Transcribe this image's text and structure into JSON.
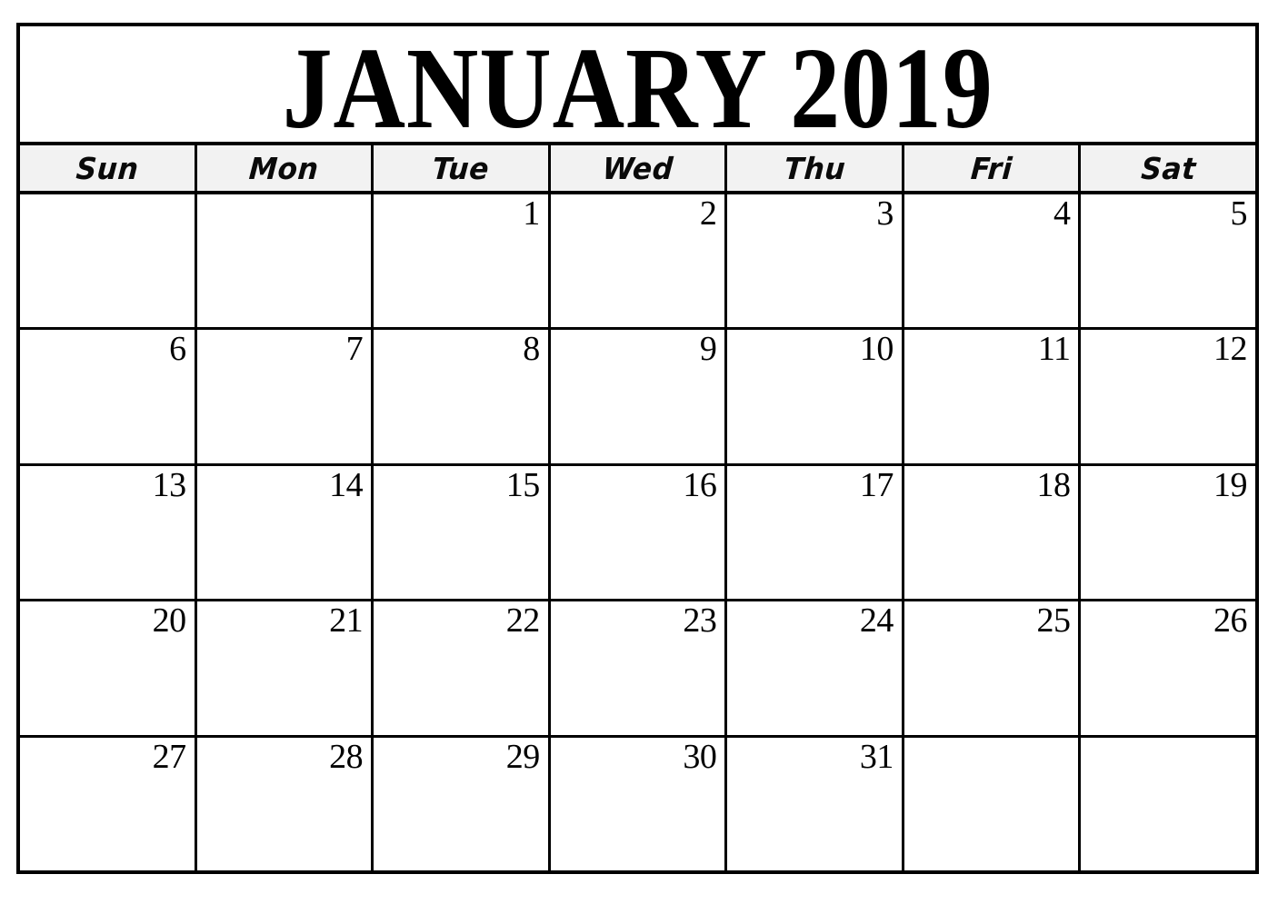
{
  "calendar": {
    "title": "JANUARY 2019",
    "month": "JANUARY",
    "year": "2019",
    "colors": {
      "border": "#000000",
      "header_background": "#f2f2f2",
      "cell_background": "#ffffff",
      "text": "#000000"
    },
    "weekdays": [
      {
        "label": "Sun"
      },
      {
        "label": "Mon"
      },
      {
        "label": "Tue"
      },
      {
        "label": "Wed"
      },
      {
        "label": "Thu"
      },
      {
        "label": "Fri"
      },
      {
        "label": "Sat"
      }
    ],
    "weeks": [
      [
        {
          "day": ""
        },
        {
          "day": ""
        },
        {
          "day": "1"
        },
        {
          "day": "2"
        },
        {
          "day": "3"
        },
        {
          "day": "4"
        },
        {
          "day": "5"
        }
      ],
      [
        {
          "day": "6"
        },
        {
          "day": "7"
        },
        {
          "day": "8"
        },
        {
          "day": "9"
        },
        {
          "day": "10"
        },
        {
          "day": "11"
        },
        {
          "day": "12"
        }
      ],
      [
        {
          "day": "13"
        },
        {
          "day": "14"
        },
        {
          "day": "15"
        },
        {
          "day": "16"
        },
        {
          "day": "17"
        },
        {
          "day": "18"
        },
        {
          "day": "19"
        }
      ],
      [
        {
          "day": "20"
        },
        {
          "day": "21"
        },
        {
          "day": "22"
        },
        {
          "day": "23"
        },
        {
          "day": "24"
        },
        {
          "day": "25"
        },
        {
          "day": "26"
        }
      ],
      [
        {
          "day": "27"
        },
        {
          "day": "28"
        },
        {
          "day": "29"
        },
        {
          "day": "30"
        },
        {
          "day": "31"
        },
        {
          "day": ""
        },
        {
          "day": ""
        }
      ]
    ]
  }
}
